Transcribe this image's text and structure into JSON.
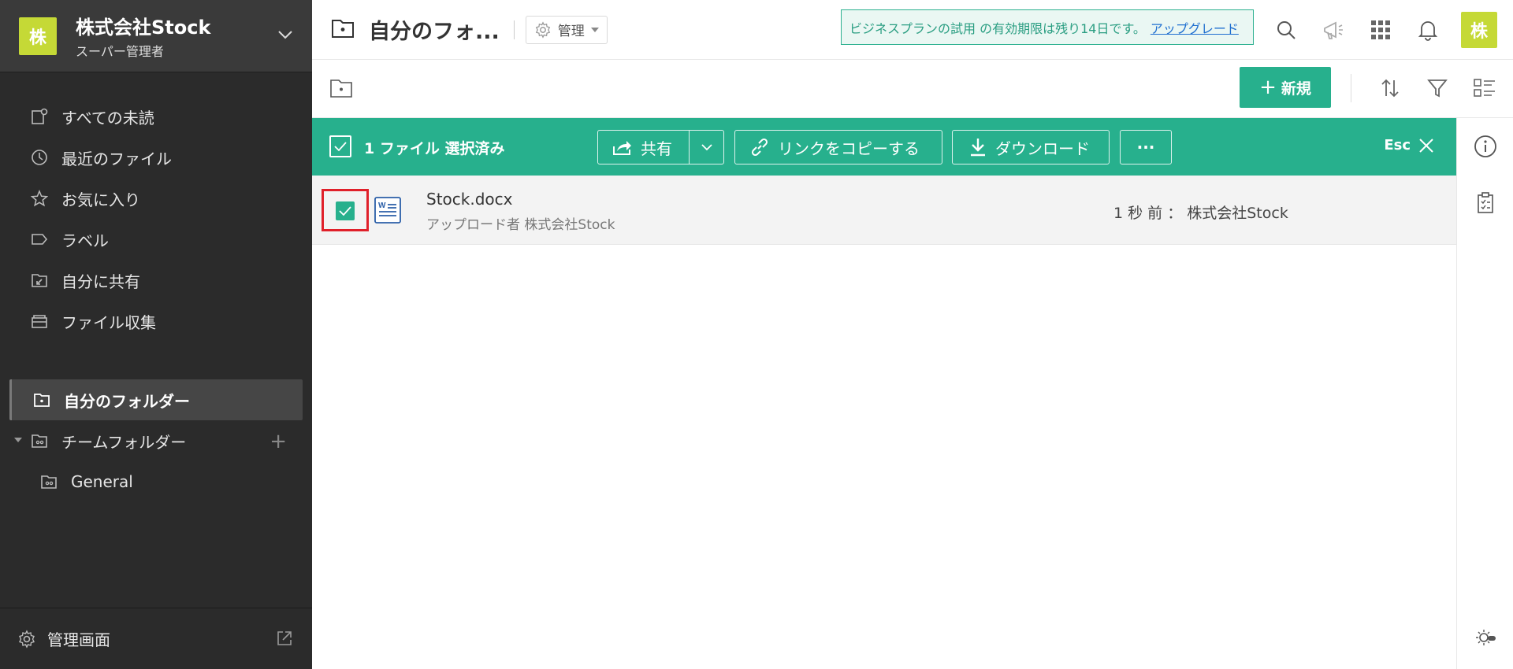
{
  "sidebar": {
    "avatar_char": "株",
    "org_name": "株式会社Stock",
    "org_role": "スーパー管理者",
    "nav_items": [
      {
        "label": "すべての未読",
        "icon": "unread-icon"
      },
      {
        "label": "最近のファイル",
        "icon": "clock-icon"
      },
      {
        "label": "お気に入り",
        "icon": "star-icon"
      },
      {
        "label": "ラベル",
        "icon": "label-icon"
      },
      {
        "label": "自分に共有",
        "icon": "shared-with-me-icon"
      },
      {
        "label": "ファイル収集",
        "icon": "file-collection-icon"
      }
    ],
    "my_folder": "自分のフォルダー",
    "team_folder": "チームフォルダー",
    "team_sub": "General",
    "footer_label": "管理画面"
  },
  "topbar": {
    "title": "自分のフォ...",
    "manage_label": "管理",
    "trial_text": "ビジネスプランの試用 の有効期限は残り14日です。",
    "upgrade_link": "アップグレード",
    "user_avatar_char": "株"
  },
  "toolbar": {
    "new_label": "新規",
    "new_plus": "+"
  },
  "selection": {
    "count_label": "1 ファイル 選択済み",
    "share_label": "共有",
    "copy_link_label": "リンクをコピーする",
    "download_label": "ダウンロード",
    "more_label": "···",
    "esc_label": "Esc"
  },
  "files": [
    {
      "name": "Stock.docx",
      "sub": "アップロード者 株式会社Stock",
      "meta": "1 秒 前 ： 株式会社Stock"
    }
  ],
  "colors": {
    "accent": "#27b08d",
    "avatar": "#c5d936",
    "sidebar_bg": "#2b2b2b",
    "highlight": "#e0202a"
  }
}
